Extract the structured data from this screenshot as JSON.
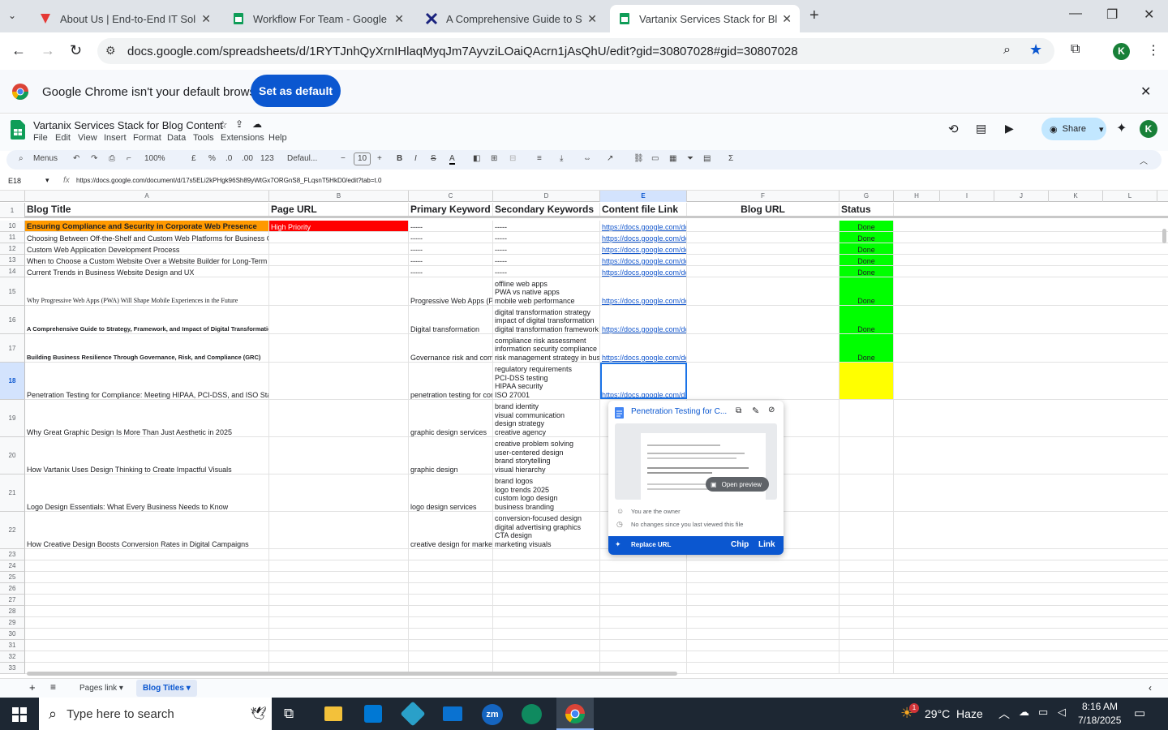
{
  "browser": {
    "tabs": [
      {
        "title": "About Us | End-to-End IT Soluti",
        "active": false
      },
      {
        "title": "Workflow For Team - Google Sh",
        "active": false
      },
      {
        "title": "A Comprehensive Guide to Stra",
        "active": false
      },
      {
        "title": "Vartanix Services Stack for Blog",
        "active": true
      }
    ],
    "url": "docs.google.com/spreadsheets/d/1RYTJnhQyXrnIHlaqMyqJm7AyvziLOaiQAcrn1jAsQhU/edit?gid=30807028#gid=30807028",
    "profile_initial": "K"
  },
  "banner": {
    "message": "Google Chrome isn't your default browser",
    "button": "Set as default"
  },
  "sheet": {
    "title": "Vartanix Services Stack for Blog Content",
    "menu": [
      "File",
      "Edit",
      "View",
      "Insert",
      "Format",
      "Data",
      "Tools",
      "Extensions",
      "Help"
    ],
    "share_label": "Share",
    "toolbar": {
      "menus": "Menus",
      "zoom": "100%",
      "currency": "£",
      "percent": "%",
      "dec_dec": ".0",
      "dec_inc": ".00",
      "numfmt": "123",
      "font": "Defaul...",
      "font_size": "10"
    },
    "cell_ref": "E18",
    "formula": "https://docs.google.com/document/d/17s5ELi2kPHgk96Sh89yWtGx7ORGnS8_FLqsnT5HkD0/edit?tab=t.0"
  },
  "grid": {
    "col_letters": [
      "A",
      "B",
      "C",
      "D",
      "E",
      "F",
      "G",
      "H",
      "I",
      "J",
      "K",
      "L"
    ],
    "headers": [
      "Blog Title",
      "Page URL",
      "Primary Keyword",
      "Secondary Keywords",
      "Content file Link",
      "Blog URL",
      "Status"
    ],
    "rows": [
      {
        "n": "10",
        "title": "Ensuring Compliance and Security in Corporate Web Presence",
        "page": "High Priority",
        "primary": "-----",
        "secondary": [
          "-----"
        ],
        "link": "https://docs.google.com/do",
        "status": "Done"
      },
      {
        "n": "11",
        "title": "Choosing Between Off-the-Shelf and Custom Web Platforms for Business Growth",
        "page": "",
        "primary": "-----",
        "secondary": [
          "-----"
        ],
        "link": "https://docs.google.com/do",
        "status": "Done"
      },
      {
        "n": "12",
        "title": "Custom Web Application Development Process",
        "page": "",
        "primary": "-----",
        "secondary": [
          "-----"
        ],
        "link": "https://docs.google.com/do",
        "status": "Done"
      },
      {
        "n": "13",
        "title": "When to Choose a Custom Website Over a Website Builder for Long-Term Growth",
        "page": "",
        "primary": "-----",
        "secondary": [
          "-----"
        ],
        "link": "https://docs.google.com/do",
        "status": "Done"
      },
      {
        "n": "14",
        "title": "Current Trends in Business Website Design and UX",
        "page": "",
        "primary": "-----",
        "secondary": [
          "-----"
        ],
        "link": "https://docs.google.com/do",
        "status": "Done"
      },
      {
        "n": "15",
        "title": "Why Progressive Web Apps (PWA) Will Shape Mobile Experiences in the Future",
        "page": "",
        "primary": "Progressive Web Apps (PWA)",
        "secondary": [
          "offline web apps",
          "PWA vs native apps",
          "mobile web performance"
        ],
        "link": "https://docs.google.com/do",
        "status": "Done"
      },
      {
        "n": "16",
        "title": "A Comprehensive Guide to Strategy, Framework, and Impact of Digital Transformation",
        "page": "",
        "primary": "Digital transformation",
        "secondary": [
          "digital transformation strategy",
          "impact of digital transformation",
          "digital transformation framework"
        ],
        "link": "https://docs.google.com/do",
        "status": "Done"
      },
      {
        "n": "17",
        "title": "Building Business Resilience Through Governance, Risk, and Compliance (GRC)",
        "page": "",
        "primary": "Governance risk and compliance",
        "secondary": [
          "compliance risk assessment",
          "information security compliance",
          "risk management strategy in business"
        ],
        "link": "https://docs.google.com/do",
        "status": "Done"
      },
      {
        "n": "18",
        "title": "Penetration Testing for Compliance: Meeting HIPAA, PCI-DSS, and ISO Standards",
        "page": "",
        "primary": "penetration testing for compliance",
        "secondary": [
          "regulatory requirements",
          "PCI-DSS testing",
          "HIPAA security",
          "ISO 27001"
        ],
        "link": "https://docs.google.com/do",
        "status": ""
      },
      {
        "n": "19",
        "title": "Why Great Graphic Design Is More Than Just Aesthetic in 2025",
        "page": "",
        "primary": "graphic design services",
        "secondary": [
          "brand identity",
          "visual communication",
          "design strategy",
          "creative agency"
        ],
        "link": "",
        "status": ""
      },
      {
        "n": "20",
        "title": "How Vartanix Uses Design Thinking to Create Impactful Visuals",
        "page": "",
        "primary": "graphic design",
        "secondary": [
          "creative problem solving",
          "user-centered design",
          "brand storytelling",
          "visual hierarchy"
        ],
        "link": "",
        "status": ""
      },
      {
        "n": "21",
        "title": "Logo Design Essentials: What Every Business Needs to Know",
        "page": "",
        "primary": "logo design services",
        "secondary": [
          "brand logos",
          "logo trends 2025",
          "custom logo design",
          "business branding"
        ],
        "link": "",
        "status": ""
      },
      {
        "n": "22",
        "title": "How Creative Design Boosts Conversion Rates in Digital Campaigns",
        "page": "",
        "primary": "creative design for marketing",
        "secondary": [
          "conversion-focused design",
          "digital advertising graphics",
          "CTA design",
          "marketing visuals"
        ],
        "link": "",
        "status": ""
      }
    ],
    "empty_rows": [
      "23",
      "24",
      "25",
      "26",
      "27",
      "28",
      "29",
      "30",
      "31",
      "32",
      "33"
    ]
  },
  "popup": {
    "title": "Penetration Testing for C...",
    "open_preview": "Open preview",
    "owner": "You are the owner",
    "changes": "No changes since you last viewed this file",
    "replace": "Replace URL",
    "chip": "Chip",
    "link": "Link"
  },
  "sheet_tabs": [
    "Pages link",
    "Blog Titles"
  ],
  "taskbar": {
    "search": "Type here to search",
    "weather": "29°C  Haze",
    "time": "8:16 AM",
    "date": "7/18/2025",
    "badge": "1"
  },
  "colors": {
    "accent": "#0b57d0",
    "done": "#00ff00",
    "priority": "#ff0000",
    "title_hl": "#ff9900",
    "pending": "#ffff00"
  }
}
